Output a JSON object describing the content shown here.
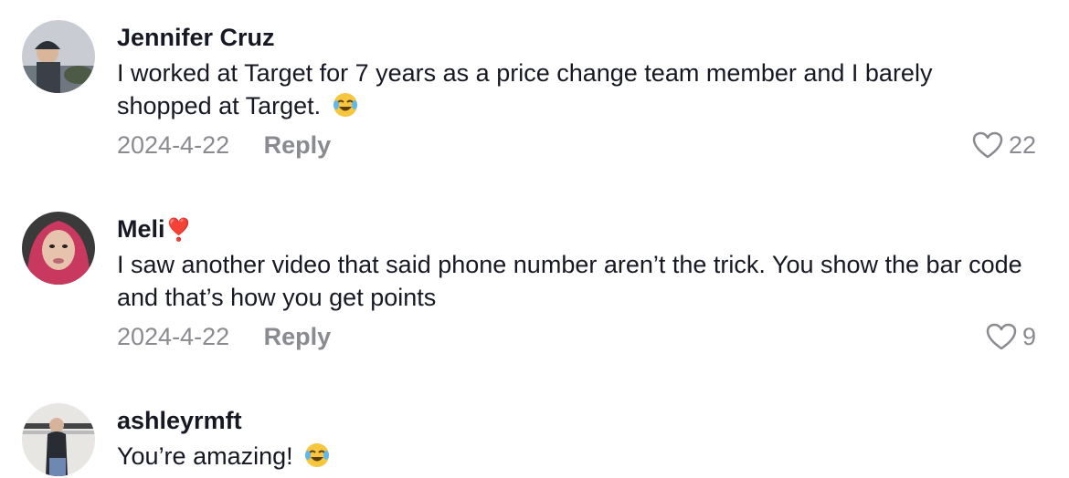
{
  "comments": [
    {
      "username": "Jennifer Cruz",
      "text": "I worked at Target for 7 years as a price change team member and I barely shopped at Target.",
      "emoji": "joy-emoji",
      "date": "2024-4-22",
      "reply_label": "Reply",
      "likes": "22"
    },
    {
      "username": "Meli",
      "username_badge": "❣️",
      "text": "I saw another video that said phone number aren’t the trick. You show the bar code and that’s how you get points",
      "date": "2024-4-22",
      "reply_label": "Reply",
      "likes": "9"
    },
    {
      "username": "ashleyrmft",
      "text": "You’re amazing!",
      "emoji": "joy-emoji"
    }
  ],
  "colors": {
    "text": "#161823",
    "meta": "#8a8b91"
  }
}
